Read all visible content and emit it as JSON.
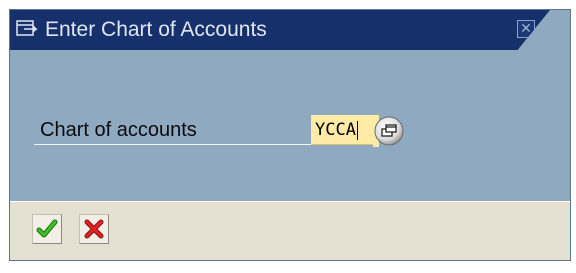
{
  "dialog": {
    "title": "Enter Chart of Accounts",
    "title_icon": "dialog-window-icon",
    "close_icon": "close-icon",
    "close_glyph": "✕"
  },
  "field": {
    "label": "Chart of accounts",
    "value": "YCCA",
    "help_icon": "f4-value-help-icon"
  },
  "buttons": {
    "confirm_icon": "green-checkmark-icon",
    "cancel_icon": "red-x-icon"
  },
  "colors": {
    "title_bar": "#16306b",
    "dialog_body": "#8fa9c1",
    "input_background": "#ffeaa6",
    "footer": "#e4e1d3",
    "confirm": "#2e9d1d",
    "cancel": "#d41e1e"
  }
}
